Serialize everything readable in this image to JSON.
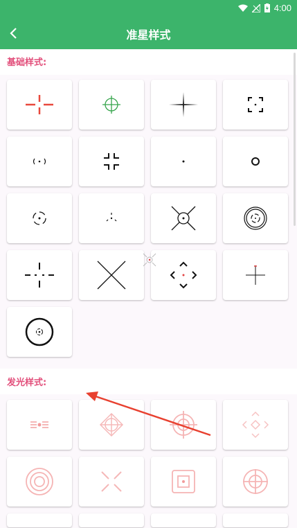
{
  "status": {
    "time": "4:00"
  },
  "appbar": {
    "title": "准星样式"
  },
  "sections": [
    {
      "title": "基础样式:"
    },
    {
      "title": "发光样式:"
    }
  ],
  "basic_styles": [
    "red-crosshair-icon",
    "green-circle-crosshair-icon",
    "thin-cross-icon",
    "corner-bracket-icon",
    "bracket-dot-icon",
    "gap-cross-icon",
    "dot-icon",
    "small-ring-icon",
    "dashed-circle-dot-icon",
    "tri-dot-icon",
    "x-cross-circle-icon",
    "double-ring-icon",
    "dashed-cross-icon",
    "large-x-icon",
    "diamond-arrows-icon",
    "thin-plus-red-dot-icon",
    "bold-ring-dot-icon"
  ],
  "glow_styles": [
    "glow-bars-icon",
    "glow-diamond-circle-icon",
    "glow-scope-icon",
    "glow-diamond-arrows-icon",
    "glow-rings-icon",
    "glow-x-icon",
    "glow-square-icon",
    "glow-target-icon"
  ],
  "colors": {
    "accent": "#3cb46b",
    "section": "#e24f7b",
    "glow": "#f29b9b"
  }
}
